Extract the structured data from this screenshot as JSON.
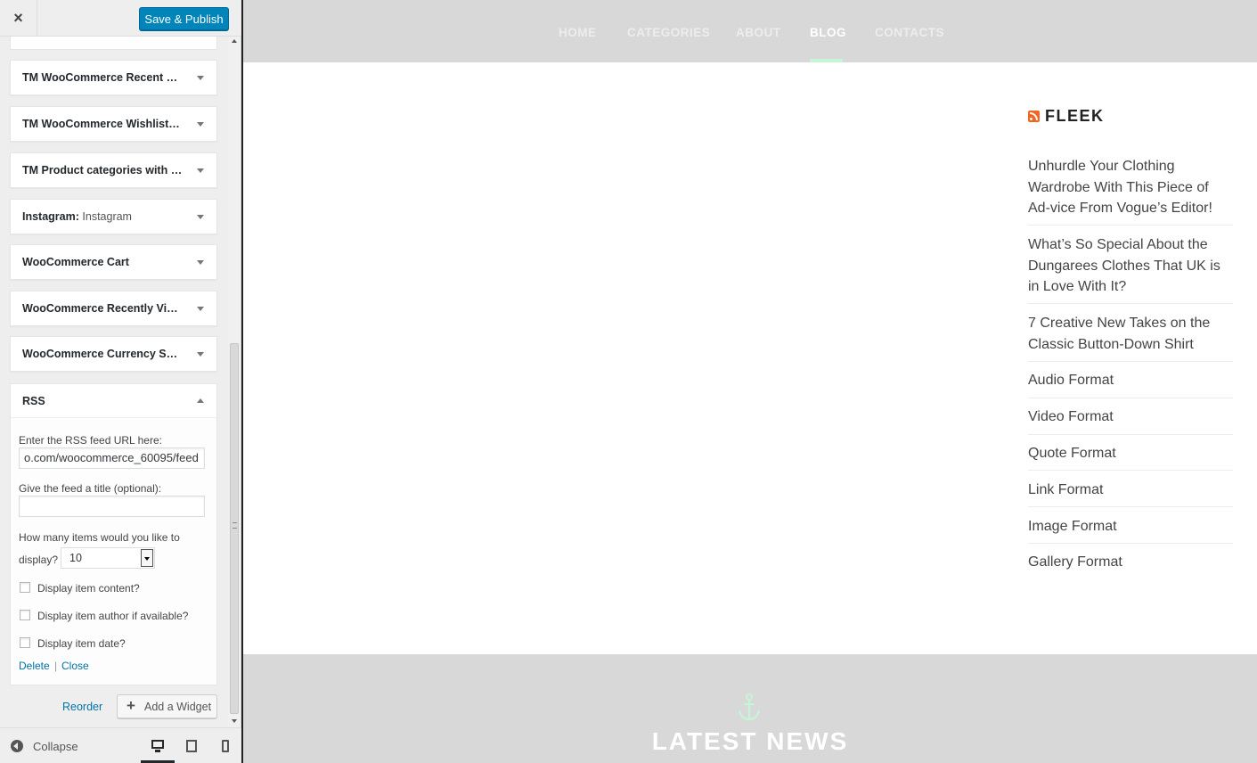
{
  "customizer": {
    "save_label": "Save & Publish",
    "close_label": "×",
    "widgets": [
      {
        "title": "TM WooCommerce Recent C…",
        "subtitle": ""
      },
      {
        "title": "TM WooCommerce Wishlist: …",
        "subtitle": ""
      },
      {
        "title": "TM Product categories with t…",
        "subtitle": ""
      },
      {
        "title": "Instagram:",
        "subtitle": "Instagram"
      },
      {
        "title": "WooCommerce Cart",
        "subtitle": ""
      },
      {
        "title": "WooCommerce Recently Vie…",
        "subtitle": ""
      },
      {
        "title": "WooCommerce Currency Swi…",
        "subtitle": ""
      }
    ],
    "rss_widget": {
      "title": "RSS",
      "url_label": "Enter the RSS feed URL here:",
      "url_value": "o.com/woocommerce_60095/feed",
      "title_label": "Give the feed a title (optional):",
      "title_value": "",
      "items_label_1": "How many items would you like to",
      "items_label_2": "display?",
      "items_value": "10",
      "checkbox_content": "Display item content?",
      "checkbox_author": "Display item author if available?",
      "checkbox_date": "Display item date?",
      "delete_label": "Delete",
      "separator": "|",
      "close_label": "Close"
    },
    "reorder_label": "Reorder",
    "add_widget_label": "Add a Widget",
    "add_widget_icon": "+",
    "collapse_label": "Collapse"
  },
  "preview": {
    "nav": [
      "HOME",
      "CATEGORIES",
      "ABOUT",
      "BLOG",
      "CONTACTS"
    ],
    "nav_active": "BLOG",
    "rss_title": "FLEEK",
    "posts": [
      "Unhurdle Your Clothing Wardrobe With This Piece of Ad-vice From Vogue’s Editor!",
      "What’s So Special About the Dungarees Clothes That UK is in Love With It?",
      "7 Creative New Takes on the Classic Button-Down Shirt",
      "Audio Format",
      "Video Format",
      "Quote Format",
      "Link Format",
      "Image Format",
      "Gallery Format"
    ],
    "news_title": "LATEST NEWS",
    "accent_color": "#c6f5d6"
  }
}
